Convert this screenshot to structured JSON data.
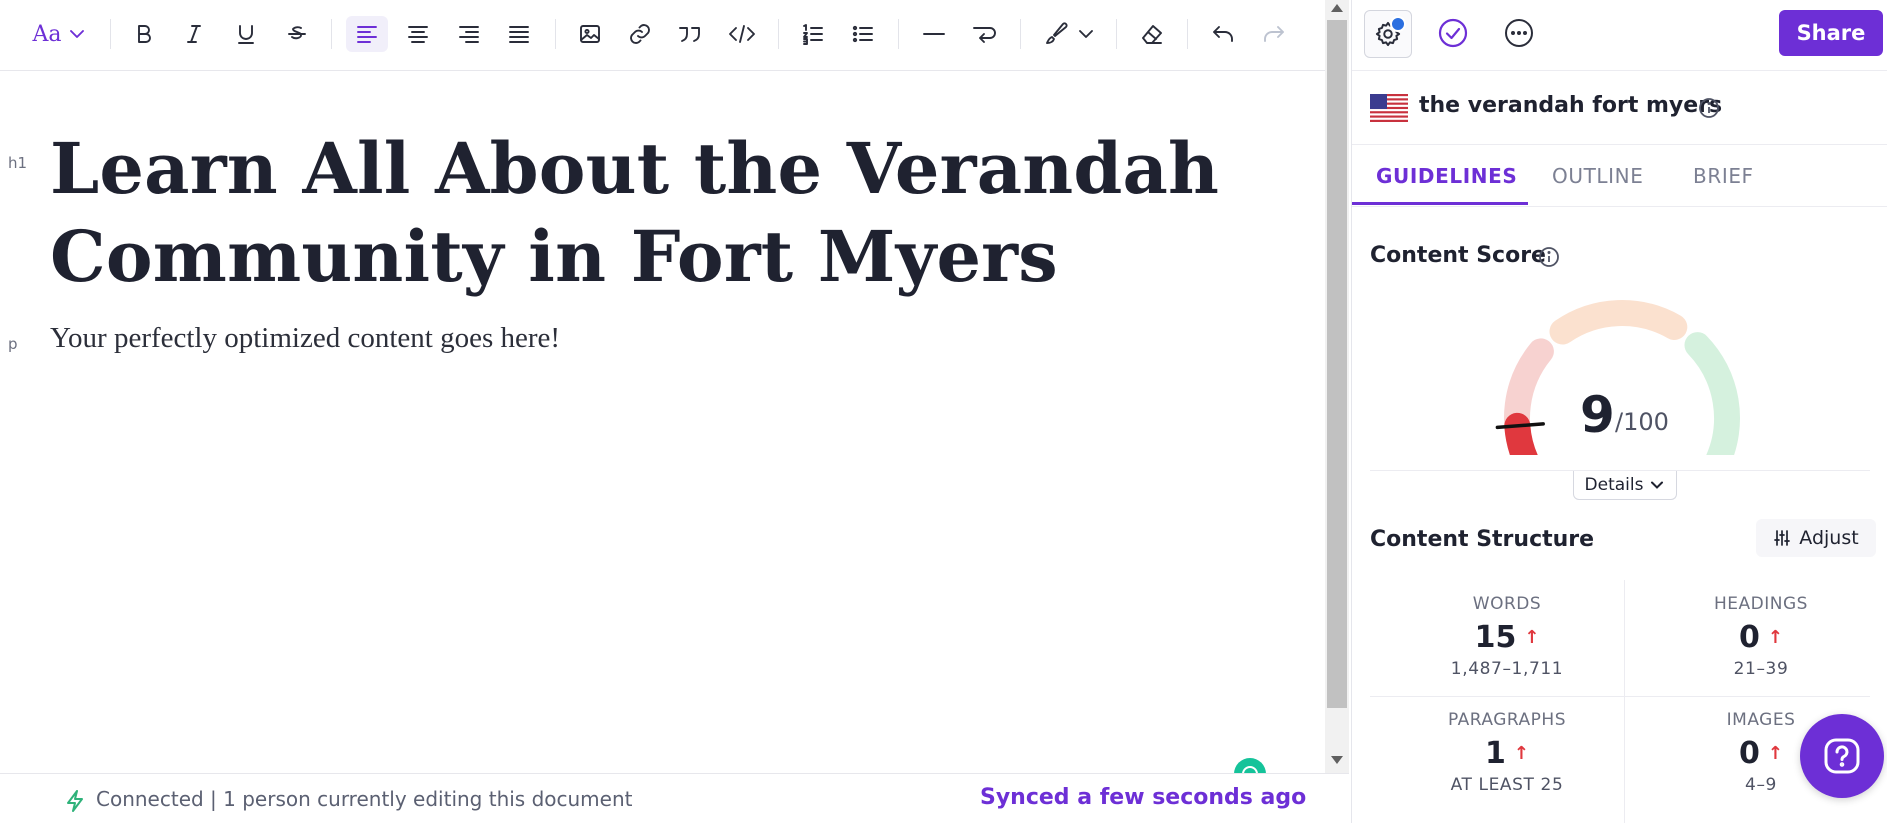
{
  "toolbar": {
    "font_label": "Aa",
    "items": [
      "font-size",
      "bold",
      "italic",
      "underline",
      "strikethrough",
      "align-left",
      "align-center",
      "align-right",
      "justify",
      "image",
      "link",
      "quote",
      "code",
      "ordered-list",
      "bullet-list",
      "horizontal-rule",
      "line-break",
      "format-painter",
      "clear-format",
      "undo",
      "redo"
    ]
  },
  "document": {
    "h1_tag": "h1",
    "h1": "Learn All About the Verandah Community in Fort Myers",
    "p_tag": "p",
    "paragraph": "Your perfectly optimized content goes here!"
  },
  "status": {
    "connection": "Connected | 1 person currently editing this document",
    "sync": "Synced a few seconds ago"
  },
  "panel": {
    "share_label": "Share",
    "keyword": "the verandah fort myers",
    "tabs": [
      "GUIDELINES",
      "OUTLINE",
      "BRIEF"
    ],
    "active_tab": "GUIDELINES",
    "content_score": {
      "title": "Content Score",
      "score": "9",
      "max": "/100",
      "details_label": "Details"
    },
    "structure": {
      "title": "Content Structure",
      "adjust_label": "Adjust",
      "metrics": [
        {
          "label": "WORDS",
          "value": "15",
          "range": "1,487–1,711"
        },
        {
          "label": "HEADINGS",
          "value": "0",
          "range": "21–39"
        },
        {
          "label": "PARAGRAPHS",
          "value": "1",
          "range": "AT LEAST 25"
        },
        {
          "label": "IMAGES",
          "value": "0",
          "range": "4–9"
        }
      ],
      "arrow": "↑"
    }
  },
  "colors": {
    "accent": "#6d2fd6",
    "score_low": "#e0383e",
    "connected": "#2fb27a"
  }
}
